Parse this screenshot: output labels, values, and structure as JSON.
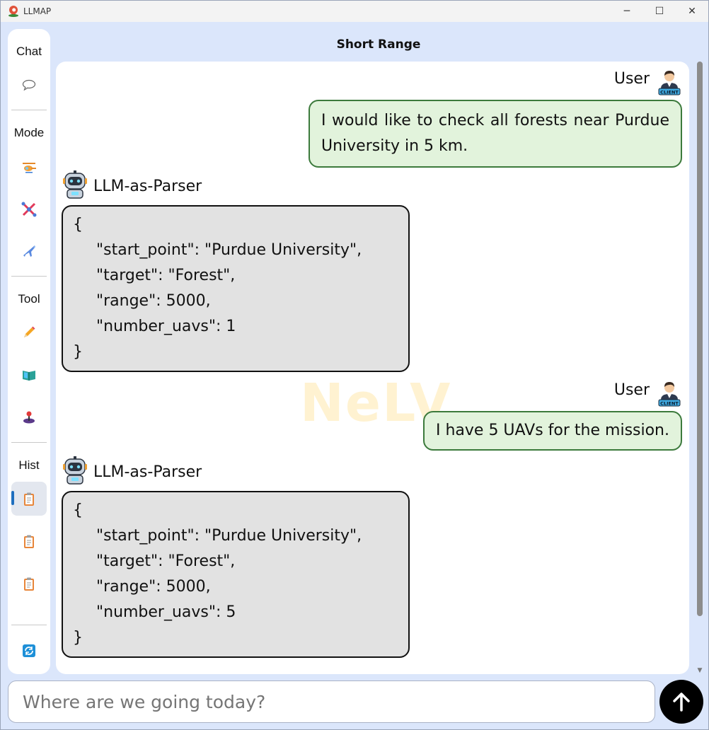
{
  "window": {
    "title": "LLMAP",
    "minimize": "─",
    "maximize": "☐",
    "close": "✕"
  },
  "sidebar": {
    "chat_label": "Chat",
    "mode_label": "Mode",
    "tool_label": "Tool",
    "hist_label": "Hist",
    "icons": {
      "chat": "chat-bubble-icon",
      "mode": [
        "helicopter-icon",
        "drone-icon",
        "airplane-icon"
      ],
      "tool": [
        "pencil-icon",
        "map-book-icon",
        "joystick-icon"
      ],
      "hist": [
        "clipboard-icon",
        "clipboard-icon",
        "clipboard-icon"
      ],
      "refresh": "refresh-icon"
    },
    "active_hist_index": 0
  },
  "header": {
    "title": "Short Range"
  },
  "watermark": "NeLV",
  "messages": [
    {
      "role": "user",
      "sender": "User",
      "text": "I would like to check all forests near Purdue University in 5 km."
    },
    {
      "role": "assistant",
      "sender": "LLM-as-Parser",
      "json_lines": [
        "{",
        "\"start_point\": \"Purdue University\",",
        "\"target\": \"Forest\",",
        "\"range\": 5000,",
        "\"number_uavs\": 1",
        "}"
      ]
    },
    {
      "role": "user",
      "sender": "User",
      "text": "I have 5 UAVs for the mission."
    },
    {
      "role": "assistant",
      "sender": "LLM-as-Parser",
      "json_lines": [
        "{",
        "\"start_point\": \"Purdue University\",",
        "\"target\": \"Forest\",",
        "\"range\": 5000,",
        "\"number_uavs\": 5",
        "}"
      ]
    }
  ],
  "input": {
    "placeholder": "Where are we going today?",
    "value": ""
  },
  "send_button": {
    "icon": "arrow-up-icon"
  },
  "colors": {
    "background": "#dbe6fb",
    "user_bubble": "#e2f3dc",
    "user_border": "#3c7a3c",
    "json_bubble": "#e2e2e2",
    "send": "#000000"
  }
}
